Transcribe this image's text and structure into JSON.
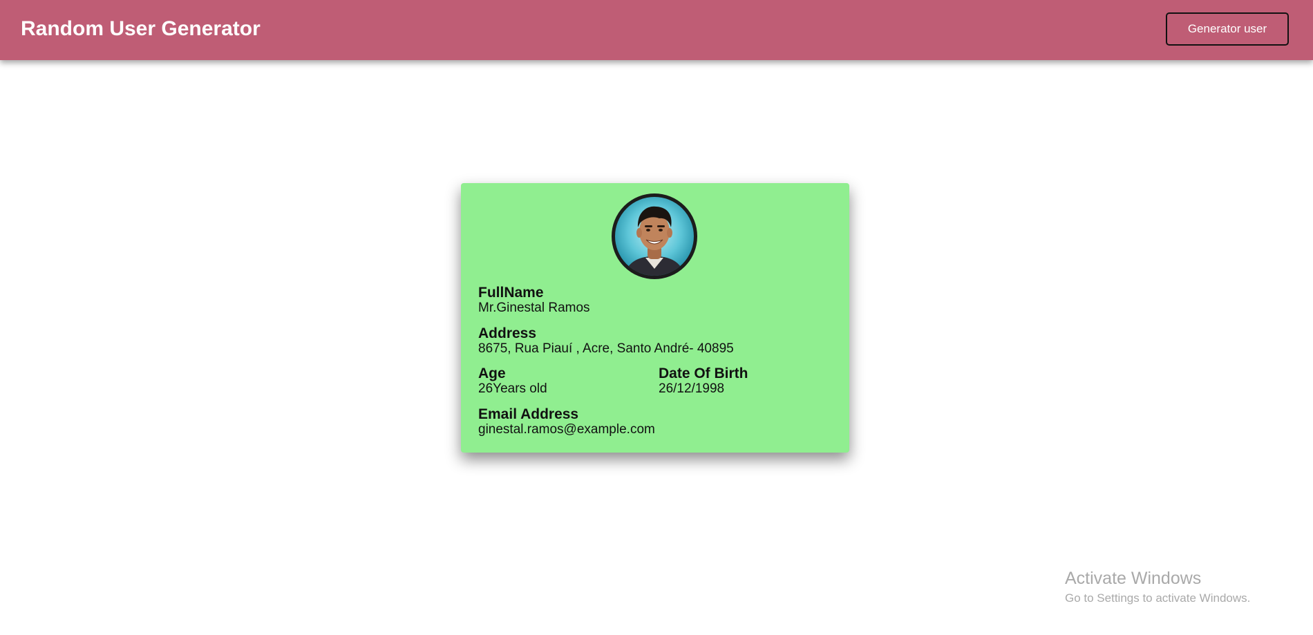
{
  "header": {
    "title": "Random User Generator",
    "generate_button_label": "Generator user",
    "background_color": "#bf5d75"
  },
  "card": {
    "background_color": "#90ee90",
    "avatar_icon": "user-photo",
    "fullname": {
      "label": "FullName",
      "value": "Mr.Ginestal Ramos"
    },
    "address": {
      "label": "Address",
      "value": "8675, Rua Piauí , Acre, Santo André- 40895"
    },
    "age": {
      "label": "Age",
      "value": "26Years old"
    },
    "dob": {
      "label": "Date Of Birth",
      "value": "26/12/1998"
    },
    "email": {
      "label": "Email Address",
      "value": "ginestal.ramos@example.com"
    }
  },
  "os_watermark": {
    "title": "Activate Windows",
    "subtitle": "Go to Settings to activate Windows."
  }
}
